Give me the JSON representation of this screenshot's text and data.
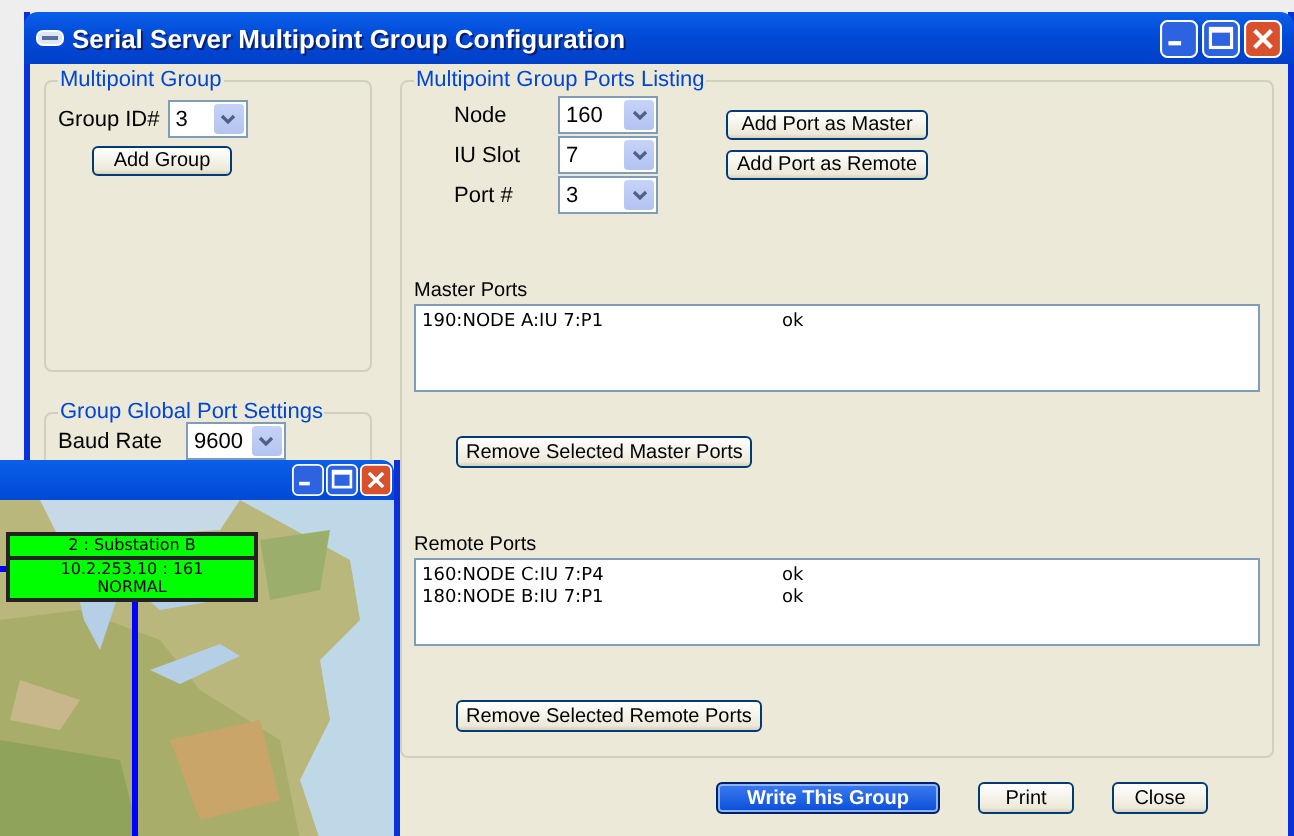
{
  "window": {
    "title": "Serial Server Multipoint Group Configuration"
  },
  "multipoint_group": {
    "title": "Multipoint Group",
    "group_id": {
      "label": "Group ID#",
      "value": "3"
    },
    "add_button": "Add Group"
  },
  "global_port_settings": {
    "title": "Group Global Port Settings",
    "baud_rate": {
      "label": "Baud Rate",
      "value": "9600"
    }
  },
  "ports_listing": {
    "title": "Multipoint Group Ports Listing",
    "selectors": [
      {
        "label": "Node",
        "value": "160"
      },
      {
        "label": "IU Slot",
        "value": "7"
      },
      {
        "label": "Port #",
        "value": "3"
      }
    ],
    "add_buttons": [
      "Add Port as Master",
      "Add Port as Remote"
    ],
    "master_ports": {
      "label": "Master Ports",
      "rows": [
        {
          "port": "190:NODE A:IU 7:P1",
          "status": "ok"
        }
      ],
      "remove_button": "Remove Selected Master Ports"
    },
    "remote_ports": {
      "label": "Remote Ports",
      "rows": [
        {
          "port": "160:NODE C:IU 7:P4",
          "status": "ok"
        },
        {
          "port": "180:NODE B:IU 7:P1",
          "status": "ok"
        }
      ],
      "remove_button": "Remove Selected Remote Ports"
    }
  },
  "buttons": [
    {
      "label": "Write This Group",
      "default": true
    },
    {
      "label": "Print",
      "default": false
    },
    {
      "label": "Close",
      "default": false
    }
  ],
  "map_window": {
    "node": {
      "name": "2 : Substation B",
      "address": "10.2.253.10 : 161",
      "status": "NORMAL"
    }
  }
}
